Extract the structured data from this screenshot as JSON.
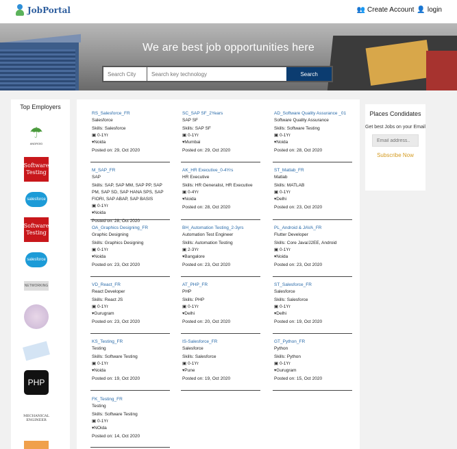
{
  "header": {
    "brand": "JobPortal",
    "create_account": "Create Account",
    "login": "login"
  },
  "hero": {
    "title": "We are best job opportunities here",
    "city_placeholder": "Search City",
    "keyword_placeholder": "Search key technology",
    "search_label": "Search"
  },
  "employers": {
    "heading": "Top Employers",
    "logos": [
      {
        "name": "android-logo",
        "text": "ANDROID"
      },
      {
        "name": "software-testing-logo",
        "text": "Software Testing"
      },
      {
        "name": "salesforce-logo",
        "text": "salesforce"
      },
      {
        "name": "software-testing-logo",
        "text": "Software Testing"
      },
      {
        "name": "salesforce-logo",
        "text": "salesforce"
      },
      {
        "name": "networking-logo",
        "text": "NETWORKING"
      },
      {
        "name": "circle-logo",
        "text": ""
      },
      {
        "name": "blue-logo",
        "text": ""
      },
      {
        "name": "php-logo",
        "text": "PHP"
      },
      {
        "name": "mechanical-engineer-logo",
        "text": "MECHANICAL ENGINEER"
      },
      {
        "name": "orange-logo",
        "text": ""
      }
    ]
  },
  "labels": {
    "skills": "Skills:",
    "posted": "Posted on: "
  },
  "jobs": [
    {
      "title": "RS_Salesforce_FR",
      "role": "Salesforce",
      "skills": "Salesforce",
      "exp": "0-1Yr",
      "city": "Noida",
      "date": "29, Oct 2020"
    },
    {
      "title": "SC_SAP SF_2Years",
      "role": "SAP SF",
      "skills": "SAP SF",
      "exp": "0-1Yr",
      "city": "Mumbai",
      "date": "29, Oct 2020"
    },
    {
      "title": "AD_Software Quality Assurance _01",
      "role": "Software Quality Assurance",
      "skills": "Software Testing",
      "exp": "0-1Yr",
      "city": "Noida",
      "date": "28, Oct 2020"
    },
    {
      "title": "M_SAP_FR",
      "role": "SAP",
      "skills": "SAP, SAP MM, SAP PP, SAP PM, SAP SD, SAP HANA SPS, SAP FIORI, SAP ABAP, SAP BASIS",
      "exp": "0-1Yr",
      "city": "Noida",
      "date": "28, Oct 2020"
    },
    {
      "title": "AK_HR Executive_0-4Yrs",
      "role": "HR Executive",
      "skills": "HR Generalist, HR Executive",
      "exp": "0-4Yr",
      "city": "Noida",
      "date": "28, Oct 2020"
    },
    {
      "title": "ST_Matlab_FR",
      "role": "Matlab",
      "skills": "MATLAB",
      "exp": "0-1Yr",
      "city": "Delhi",
      "date": "23, Oct 2020"
    },
    {
      "title": "OA_Graphics Designing_FR",
      "role": "Graphic Designing",
      "skills": "Graphics Designing",
      "exp": "0-1Yr",
      "city": "Noida",
      "date": "23, Oct 2020"
    },
    {
      "title": "BH_Automation Testing_2-3yrs",
      "role": "Automation Test Engineer",
      "skills": "Automation Testing",
      "exp": "2-3Yr",
      "city": "Bangalore",
      "date": "23, Oct 2020"
    },
    {
      "title": "PL_Android & JAVA_FR",
      "role": "Flutter Developer",
      "skills": "Core Java/J2EE, Android",
      "exp": "0-1Yr",
      "city": "Noida",
      "date": "23, Oct 2020"
    },
    {
      "title": "VD_React_FR",
      "role": "React Developer",
      "skills": "React JS",
      "exp": "0-1Yr",
      "city": "Gurugram",
      "date": "23, Oct 2020"
    },
    {
      "title": "AT_PHP_FR",
      "role": "PHP",
      "skills": "PHP",
      "exp": "0-1Yr",
      "city": "Delhi",
      "date": "20, Oct 2020"
    },
    {
      "title": "ST_Salesforce_FR",
      "role": "Salesforce",
      "skills": "Salesforce",
      "exp": "0-1Yr",
      "city": "Delhi",
      "date": "19, Oct 2020"
    },
    {
      "title": "KS_Testing_FR",
      "role": "Testing",
      "skills": "Software Testing",
      "exp": "0-1Yr",
      "city": "Noida",
      "date": "19, Oct 2020"
    },
    {
      "title": "IS-Salesforce_FR",
      "role": "Salesforce",
      "skills": "Salesforce",
      "exp": "0-1Yr",
      "city": "Pune",
      "date": "19, Oct 2020"
    },
    {
      "title": "GT_Python_FR",
      "role": "Python",
      "skills": "Python",
      "exp": "0-1Yr",
      "city": "Gurugram",
      "date": "15, Oct 2020"
    },
    {
      "title": "FK_Testing_FR",
      "role": "Testing",
      "skills": "Software Testing",
      "exp": "0-1Yr",
      "city": "NOida",
      "date": "14, Oct 2020"
    }
  ],
  "subscribe": {
    "heading": "Places Condidates",
    "text": "Get best Jobs on your Email",
    "placeholder": "Email address..",
    "button": "Subscribe Now"
  }
}
